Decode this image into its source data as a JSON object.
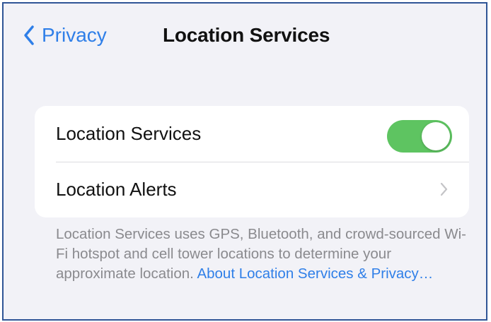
{
  "navbar": {
    "back_label": "Privacy",
    "title": "Location Services"
  },
  "settings": {
    "rows": [
      {
        "label": "Location Services",
        "control": "toggle",
        "toggle_on": true
      },
      {
        "label": "Location Alerts",
        "control": "chevron-right-icon"
      }
    ]
  },
  "footer": {
    "description": "Location Services uses GPS, Bluetooth, and crowd-sourced Wi-Fi hotspot and cell tower locations to determine your approximate location.",
    "link": "About Location Services & Privacy…"
  },
  "colors": {
    "accent": "#2f7fe8",
    "toggle_on": "#5ec461",
    "background": "#f2f2f7",
    "footer_text": "#8a8a8e"
  }
}
